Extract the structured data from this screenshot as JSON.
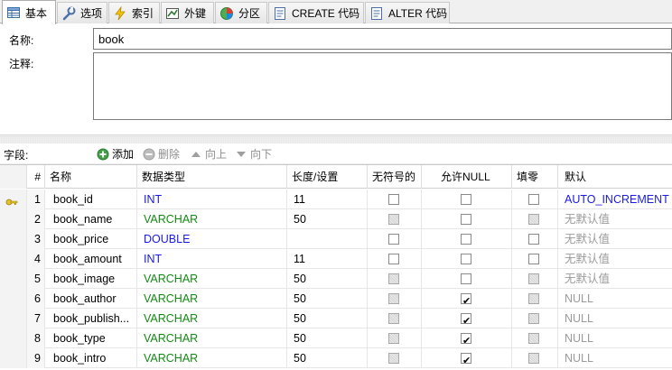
{
  "tabs": [
    {
      "label": "基本",
      "icon": "table-icon",
      "active": true
    },
    {
      "label": "选项",
      "icon": "wrench-icon"
    },
    {
      "label": "索引",
      "icon": "lightning-icon"
    },
    {
      "label": "外键",
      "icon": "foreign-key-icon"
    },
    {
      "label": "分区",
      "icon": "partition-icon"
    },
    {
      "label": "CREATE 代码",
      "icon": "code-icon"
    },
    {
      "label": "ALTER 代码",
      "icon": "code-icon"
    }
  ],
  "form": {
    "name_label": "名称:",
    "name_value": "book",
    "comment_label": "注释:",
    "comment_value": ""
  },
  "toolbar": {
    "fields_label": "字段:",
    "add": "添加",
    "delete": "删除",
    "up": "向上",
    "down": "向下"
  },
  "columns": {
    "num": "#",
    "name": "名称",
    "type": "数据类型",
    "length": "长度/设置",
    "unsigned": "无符号的",
    "allow_null": "允许NULL",
    "zerofill": "填零",
    "default": "默认"
  },
  "rows": [
    {
      "num": "1",
      "name": "book_id",
      "type": "INT",
      "length": "11",
      "unsigned": false,
      "unsigned_enabled": true,
      "allow_null": false,
      "zerofill": false,
      "zerofill_enabled": true,
      "default": "AUTO_INCREMENT",
      "primary_key": true
    },
    {
      "num": "2",
      "name": "book_name",
      "type": "VARCHAR",
      "length": "50",
      "unsigned": false,
      "unsigned_enabled": false,
      "allow_null": false,
      "zerofill": false,
      "zerofill_enabled": false,
      "default": "无默认值"
    },
    {
      "num": "3",
      "name": "book_price",
      "type": "DOUBLE",
      "length": "",
      "unsigned": false,
      "unsigned_enabled": true,
      "allow_null": false,
      "zerofill": false,
      "zerofill_enabled": true,
      "default": "无默认值"
    },
    {
      "num": "4",
      "name": "book_amount",
      "type": "INT",
      "length": "11",
      "unsigned": false,
      "unsigned_enabled": true,
      "allow_null": false,
      "zerofill": false,
      "zerofill_enabled": true,
      "default": "无默认值"
    },
    {
      "num": "5",
      "name": "book_image",
      "type": "VARCHAR",
      "length": "50",
      "unsigned": false,
      "unsigned_enabled": false,
      "allow_null": false,
      "zerofill": false,
      "zerofill_enabled": false,
      "default": "无默认值"
    },
    {
      "num": "6",
      "name": "book_author",
      "type": "VARCHAR",
      "length": "50",
      "unsigned": false,
      "unsigned_enabled": false,
      "allow_null": true,
      "zerofill": false,
      "zerofill_enabled": false,
      "default": "NULL"
    },
    {
      "num": "7",
      "name": "book_publish...",
      "type": "VARCHAR",
      "length": "50",
      "unsigned": false,
      "unsigned_enabled": false,
      "allow_null": true,
      "zerofill": false,
      "zerofill_enabled": false,
      "default": "NULL"
    },
    {
      "num": "8",
      "name": "book_type",
      "type": "VARCHAR",
      "length": "50",
      "unsigned": false,
      "unsigned_enabled": false,
      "allow_null": true,
      "zerofill": false,
      "zerofill_enabled": false,
      "default": "NULL"
    },
    {
      "num": "9",
      "name": "book_intro",
      "type": "VARCHAR",
      "length": "50",
      "unsigned": false,
      "unsigned_enabled": false,
      "allow_null": true,
      "zerofill": false,
      "zerofill_enabled": false,
      "default": "NULL"
    }
  ],
  "colors": {
    "type_blue": "#1a1ae6",
    "type_green": "#138a13",
    "default_gray": "#9a9a9a"
  }
}
